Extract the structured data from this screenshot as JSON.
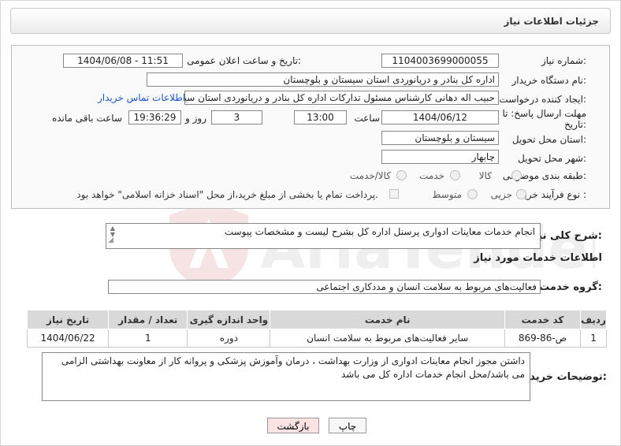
{
  "panel": {
    "title": "جزئیات اطلاعات نیاز"
  },
  "form": {
    "need_number_label": "شماره نیاز:",
    "need_number": "1104003699000055",
    "announce_label": "تاریخ و ساعت اعلان عمومی:",
    "announce_value": "1404/06/08 - 11:51",
    "buyer_org_label": "نام دستگاه خریدار:",
    "buyer_org": "اداره کل بنادر و دریانوردی استان سیستان و بلوچستان",
    "requester_label": "ایجاد کننده درخواست:",
    "requester": "حبیب اله دهانی کارشناس مسئول تدارکات اداره کل بنادر و دریانوردی استان سیستان و بلوچستان",
    "contact_link": "اطلاعات تماس خریدار",
    "deadline_label_1": "مهلت ارسال پاسخ: تا",
    "deadline_label_2": "تاریخ:",
    "deadline_date": "1404/06/12",
    "time_label": "ساعت",
    "deadline_time": "13:00",
    "days_value": "3",
    "days_label": "روز و",
    "remaining_time": "19:36:29",
    "remaining_label": "ساعت باقی مانده",
    "province_label": "استان محل تحویل:",
    "province": "سیستان و بلوچستان",
    "city_label": "شهر محل تحویل:",
    "city": "چابهار",
    "category_label": "طبقه بندی موضوعی:",
    "category_options": [
      "کالا",
      "خدمت",
      "کالا/خدمت"
    ],
    "process_label": "نوع فرآیند خرید :",
    "process_options": [
      "جزیی",
      "متوسط"
    ],
    "payment_note": "پرداخت تمام یا بخشی از مبلغ خرید،از محل \"اسناد خزانه اسلامی\" خواهد بود."
  },
  "summary": {
    "label": "شرح کلی نیاز:",
    "text": "انجام خدمات معاینات ادواری پرسنل اداره کل بشرح لیست و مشخصات پیوست"
  },
  "services": {
    "section_title": "اطلاعات خدمات مورد نیاز",
    "group_label": "گروه خدمت:",
    "group_value": "فعالیت‌های مربوط به سلامت انسان و مددکاری اجتماعی",
    "columns": [
      "ردیف",
      "کد خدمت",
      "نام خدمت",
      "واحد اندازه گیری",
      "تعداد / مقدار",
      "تاریخ نیاز"
    ],
    "rows": [
      [
        "1",
        "ص-86-869",
        "سایر فعالیت‌های مربوط به سلامت انسان",
        "دوره",
        "1",
        "1404/06/22"
      ]
    ]
  },
  "notes": {
    "label": "توضیحات خریدار:",
    "text": "داشتن مجوز انجام معاینات ادواری از وزارت بهداشت ، درمان وآموزش پزشکی و پروانه کار از معاونت بهداشتی الزامی می باشد/محل انجام خدمات اداره کل می باشد"
  },
  "buttons": {
    "print": "چاپ",
    "back": "بازگشت"
  },
  "watermark": {
    "text": "AriaTender.net"
  },
  "colors": {
    "link": "#1a56c8",
    "back_button_bg": "#fbe3e3",
    "header_grey": "#d9d9d9"
  }
}
